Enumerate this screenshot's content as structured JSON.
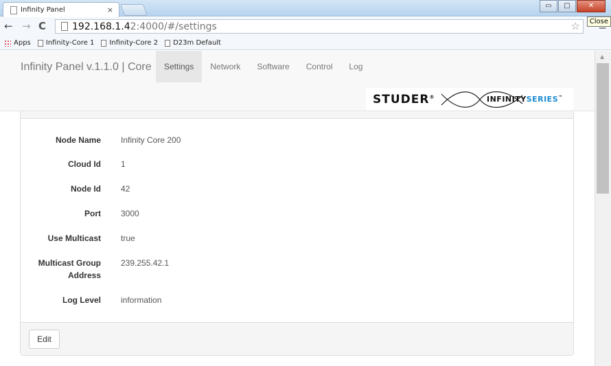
{
  "browser": {
    "tab_title": "Infinity Panel",
    "tab_close": "×",
    "window_buttons": {
      "minimize": "▭",
      "maximize": "□",
      "close": "✕"
    },
    "tooltip": "Close",
    "url_host": "192.168.1.4",
    "url_path": "2:4000/#/settings",
    "bookmarks": [
      {
        "label": "Apps",
        "icon": "apps-icon"
      },
      {
        "label": "Infinity-Core 1",
        "icon": "page-icon"
      },
      {
        "label": "Infinity-Core 2",
        "icon": "page-icon"
      },
      {
        "label": "D23m Default",
        "icon": "page-icon"
      }
    ],
    "nav_icons": {
      "back": "←",
      "forward": "→",
      "reload": "C",
      "star": "☆",
      "menu": "≡"
    }
  },
  "navbar": {
    "brand": "Infinity Panel v.1.1.0 | Core",
    "links": [
      {
        "label": "Settings",
        "active": true
      },
      {
        "label": "Network",
        "active": false
      },
      {
        "label": "Software",
        "active": false
      },
      {
        "label": "Control",
        "active": false
      },
      {
        "label": "Log",
        "active": false
      }
    ]
  },
  "logo": {
    "studer": "STUDER",
    "reg": "®",
    "infinity": "INFINITY",
    "series": "SERIES",
    "tm": "™",
    "series_color": "#1a8bd1"
  },
  "settings": {
    "rows": [
      {
        "label": "Node Name",
        "value": "Infinity Core 200"
      },
      {
        "label": "Cloud Id",
        "value": "1"
      },
      {
        "label": "Node Id",
        "value": "42"
      },
      {
        "label": "Port",
        "value": "3000"
      },
      {
        "label": "Use Multicast",
        "value": "true"
      },
      {
        "label": "Multicast Group Address",
        "value": "239.255.42.1"
      },
      {
        "label": "Log Level",
        "value": "information"
      }
    ],
    "edit_label": "Edit"
  }
}
